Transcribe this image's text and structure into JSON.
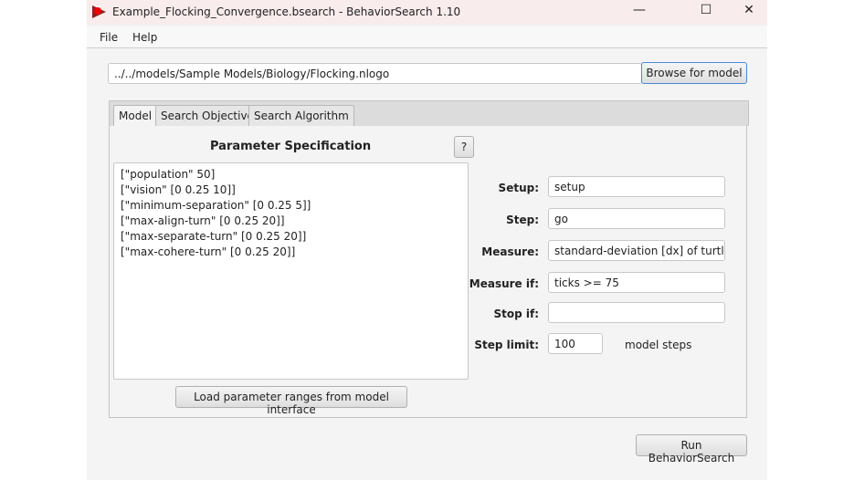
{
  "window": {
    "title": "Example_Flocking_Convergence.bsearch - BehaviorSearch 1.10",
    "minimize": "—",
    "maximize": "☐",
    "close": "✕"
  },
  "menu": [
    "File",
    "Help"
  ],
  "model_path": "../../models/Sample Models/Biology/Flocking.nlogo",
  "browse_label": "Browse for model",
  "tabs": [
    "Model",
    "Search Objective",
    "Search Algorithm"
  ],
  "param_heading": "Parameter Specification",
  "help_label": "?",
  "params": [
    "[\"population\" 50]",
    "[\"vision\" [0 0.25 10]]",
    "[\"minimum-separation\" [0 0.25 5]]",
    "[\"max-align-turn\" [0 0.25 20]]",
    "[\"max-separate-turn\" [0 0.25 20]]",
    "[\"max-cohere-turn\" [0 0.25 20]]"
  ],
  "load_label": "Load parameter ranges from model interface",
  "form": {
    "setup_label": "Setup:",
    "setup": "setup",
    "step_label": "Step:",
    "step": "go",
    "measure_label": "Measure:",
    "measure": "standard-deviation [dx] of turtles",
    "measure_if_label": "Measure if:",
    "measure_if": "ticks >= 75",
    "stop_if_label": "Stop if:",
    "stop_if": "",
    "step_limit_label": "Step limit:",
    "step_limit": "100",
    "step_units": "model steps"
  },
  "run_label": "Run BehaviorSearch"
}
